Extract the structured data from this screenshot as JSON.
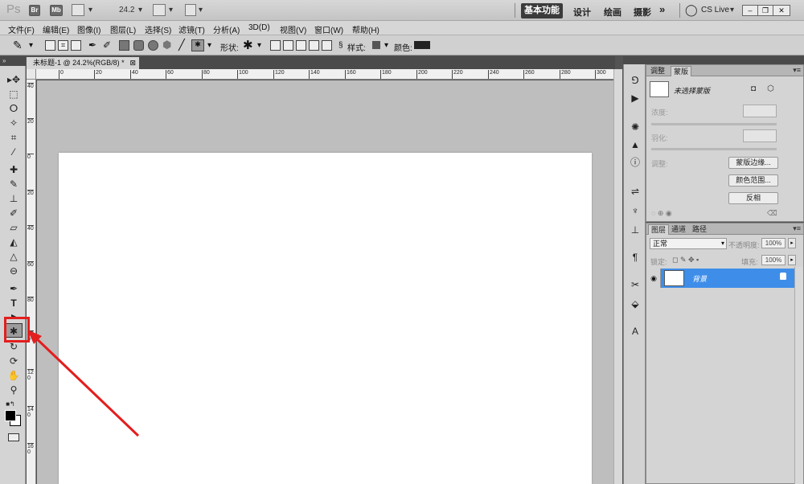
{
  "appbar": {
    "logo": "Ps",
    "btn_br": "Br",
    "btn_mb": "Mb",
    "zoom": "24.2",
    "workspaces": [
      "基本功能",
      "设计",
      "绘画",
      "摄影"
    ],
    "more": "»",
    "cslive": "CS Live"
  },
  "menu": [
    "文件(F)",
    "编辑(E)",
    "图像(I)",
    "图层(L)",
    "选择(S)",
    "滤镜(T)",
    "分析(A)",
    "3D(D)",
    "视图(V)",
    "窗口(W)",
    "帮助(H)"
  ],
  "options": {
    "shape_label": "形状:",
    "style_label": "样式:",
    "color_label": "颜色:",
    "color_value": "#000000"
  },
  "document": {
    "tab_title": "未标题-1 @ 24.2%(RGB/8) *",
    "ruler_h": [
      "0",
      "20",
      "40",
      "60",
      "80",
      "100",
      "120",
      "140",
      "160",
      "180",
      "200",
      "220",
      "240",
      "260",
      "280",
      "300"
    ],
    "ruler_v": [
      "40",
      "20",
      "0",
      "20",
      "40",
      "60",
      "80",
      "100",
      "120",
      "140",
      "160",
      "180"
    ],
    "canvas_color": "#ffffff"
  },
  "tools": {
    "icons": [
      "move-icon",
      "marquee-icon",
      "lasso-icon",
      "quick-select-icon",
      "crop-icon",
      "eyedropper-icon",
      "healing-icon",
      "brush-icon",
      "stamp-icon",
      "history-brush-icon",
      "eraser-icon",
      "bucket-icon",
      "blur-icon",
      "dodge-icon",
      "pen-icon",
      "type-icon",
      "path-select-icon",
      "custom-shape-icon",
      "3d-rotate-icon",
      "3d-orbit-icon",
      "hand-icon",
      "zoom-icon"
    ]
  },
  "masks_panel": {
    "tabs": [
      "调整",
      "蒙版"
    ],
    "title": "未选择蒙版",
    "density_label": "浓度:",
    "feather_label": "羽化:",
    "refine_label": "调整:",
    "buttons": [
      "蒙版边缘...",
      "颜色范围...",
      "反相"
    ]
  },
  "layers_panel": {
    "tabs": [
      "图层",
      "通道",
      "路径"
    ],
    "blend_mode": "正常",
    "opacity_label": "不透明度:",
    "opacity_value": "100%",
    "lock_label": "锁定:",
    "fill_label": "填充:",
    "fill_value": "100%",
    "layer_name": "背景"
  },
  "annotation": {
    "color": "#e31e1e"
  }
}
